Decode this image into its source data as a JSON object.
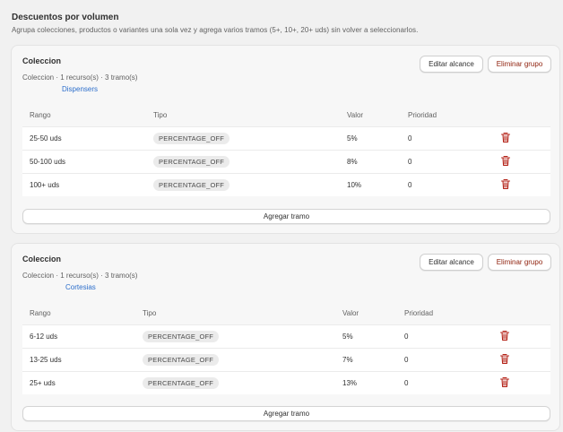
{
  "header": {
    "title": "Descuentos por volumen",
    "subtitle": "Agrupa colecciones, productos o variantes una sola vez y agrega varios tramos (5+, 10+, 20+ uds) sin volver a seleccionarlos."
  },
  "columns": {
    "rango": "Rango",
    "tipo": "Tipo",
    "valor": "Valor",
    "prioridad": "Prioridad"
  },
  "buttons": {
    "edit": "Editar alcance",
    "delete": "Eliminar grupo",
    "add_tier": "Agregar tramo"
  },
  "colors": {
    "link": "#2c6ecb",
    "danger": "#8e1f0b"
  },
  "groups": [
    {
      "title": "Coleccion",
      "meta": "Coleccion · 1 recurso(s) · 3 tramo(s)",
      "resource": "Dispensers",
      "tiers": [
        {
          "rango": "25-50 uds",
          "tipo": "PERCENTAGE_OFF",
          "valor": "5%",
          "prioridad": "0"
        },
        {
          "rango": "50-100 uds",
          "tipo": "PERCENTAGE_OFF",
          "valor": "8%",
          "prioridad": "0"
        },
        {
          "rango": "100+ uds",
          "tipo": "PERCENTAGE_OFF",
          "valor": "10%",
          "prioridad": "0"
        }
      ]
    },
    {
      "title": "Coleccion",
      "meta": "Coleccion · 1 recurso(s) · 3 tramo(s)",
      "resource": "Cortesias",
      "tiers": [
        {
          "rango": "6-12 uds",
          "tipo": "PERCENTAGE_OFF",
          "valor": "5%",
          "prioridad": "0"
        },
        {
          "rango": "13-25 uds",
          "tipo": "PERCENTAGE_OFF",
          "valor": "7%",
          "prioridad": "0"
        },
        {
          "rango": "25+ uds",
          "tipo": "PERCENTAGE_OFF",
          "valor": "13%",
          "prioridad": "0"
        }
      ]
    }
  ]
}
